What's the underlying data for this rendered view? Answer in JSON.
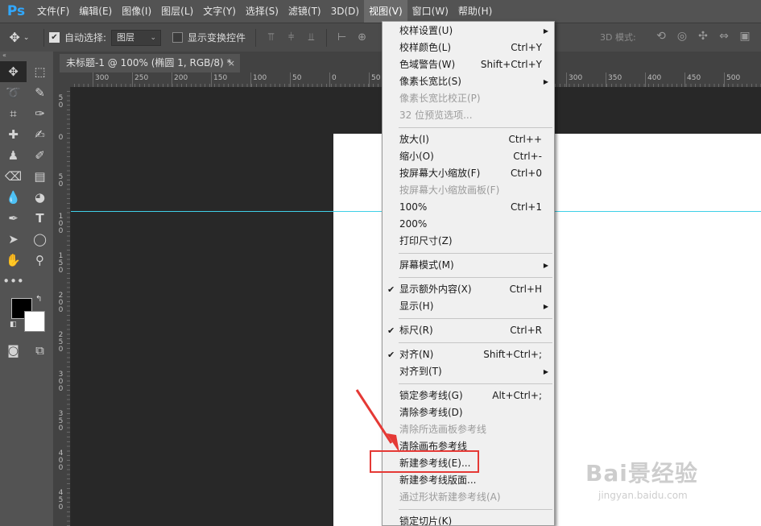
{
  "app": {
    "logo": "Ps"
  },
  "menubar": {
    "items": [
      "文件(F)",
      "编辑(E)",
      "图像(I)",
      "图层(L)",
      "文字(Y)",
      "选择(S)",
      "滤镜(T)",
      "3D(D)",
      "视图(V)",
      "窗口(W)",
      "帮助(H)"
    ],
    "active": "视图(V)"
  },
  "options": {
    "auto_select_label": "自动选择:",
    "auto_select_checked": true,
    "layer_select_value": "图层",
    "show_transform_label": "显示变换控件",
    "show_transform_checked": false,
    "mode_3d_label": "3D 模式:"
  },
  "tab": {
    "title": "未标题-1 @ 100% (椭圆 1, RGB/8) *",
    "close": "×"
  },
  "rulers": {
    "h_labels": [
      "300",
      "250",
      "200",
      "150",
      "100",
      "50",
      "0",
      "50",
      "100",
      "150",
      "200",
      "250",
      "300",
      "350",
      "400",
      "450",
      "500"
    ],
    "v_labels": [
      "50",
      "0",
      "50",
      "100",
      "150",
      "200",
      "250",
      "300",
      "350",
      "400",
      "450"
    ]
  },
  "view_menu": {
    "items": [
      {
        "label": "校样设置(U)",
        "submenu": true
      },
      {
        "label": "校样颜色(L)",
        "shortcut": "Ctrl+Y"
      },
      {
        "label": "色域警告(W)",
        "shortcut": "Shift+Ctrl+Y"
      },
      {
        "label": "像素长宽比(S)",
        "submenu": true
      },
      {
        "label": "像素长宽比校正(P)",
        "disabled": true
      },
      {
        "label": "32 位预览选项...",
        "disabled": true
      },
      {
        "separator": true
      },
      {
        "label": "放大(I)",
        "shortcut": "Ctrl++"
      },
      {
        "label": "缩小(O)",
        "shortcut": "Ctrl+-"
      },
      {
        "label": "按屏幕大小缩放(F)",
        "shortcut": "Ctrl+0"
      },
      {
        "label": "按屏幕大小缩放画板(F)",
        "disabled": true
      },
      {
        "label": "100%",
        "shortcut": "Ctrl+1"
      },
      {
        "label": "200%"
      },
      {
        "label": "打印尺寸(Z)"
      },
      {
        "separator": true
      },
      {
        "label": "屏幕模式(M)",
        "submenu": true
      },
      {
        "separator": true
      },
      {
        "label": "显示额外内容(X)",
        "shortcut": "Ctrl+H",
        "checked": true
      },
      {
        "label": "显示(H)",
        "submenu": true
      },
      {
        "separator": true
      },
      {
        "label": "标尺(R)",
        "shortcut": "Ctrl+R",
        "checked": true
      },
      {
        "separator": true
      },
      {
        "label": "对齐(N)",
        "shortcut": "Shift+Ctrl+;",
        "checked": true
      },
      {
        "label": "对齐到(T)",
        "submenu": true
      },
      {
        "separator": true
      },
      {
        "label": "锁定参考线(G)",
        "shortcut": "Alt+Ctrl+;"
      },
      {
        "label": "清除参考线(D)"
      },
      {
        "label": "清除所选画板参考线",
        "disabled": true
      },
      {
        "label": "清除画布参考线"
      },
      {
        "label": "新建参考线(E)...",
        "highlighted": true
      },
      {
        "label": "新建参考线版面..."
      },
      {
        "label": "通过形状新建参考线(A)",
        "disabled": true
      },
      {
        "separator": true
      },
      {
        "label": "锁定切片(K)"
      }
    ]
  },
  "watermark": {
    "main": "Bai景经验",
    "sub": "jingyan.baidu.com"
  },
  "colors": {
    "accent_guide": "#3fd0e8",
    "highlight_box": "#e53935",
    "ps_blue": "#31a8ff"
  }
}
